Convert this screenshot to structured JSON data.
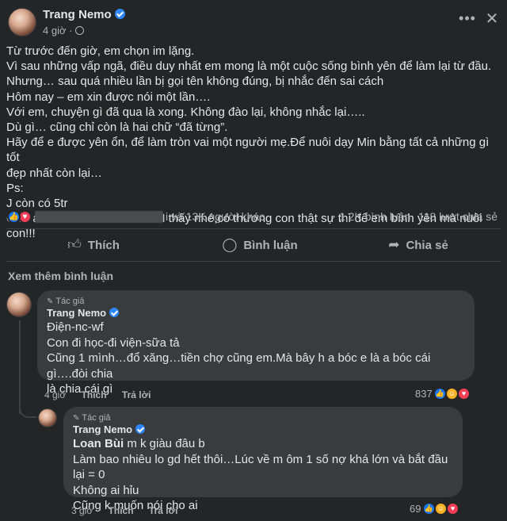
{
  "post": {
    "author": "Trang Nemo",
    "time": "4 giờ",
    "body_lines": [
      "Từ trước đến giờ, em chọn im lặng.",
      "Vì sau những vấp ngã, điều duy nhất em mong là một cuộc sống bình yên để làm lại từ đầu.",
      "Nhưng… sau quá nhiều lần bị gọi tên không đúng, bị nhắc đến sai cách",
      "Hôm nay – em xin được nói một lần….",
      "Với em, chuyện gì đã qua là xong. Không đào lại, không nhắc lại…..",
      "Dù gì… cũng chỉ còn là hai chữ “đã từng”.",
      "Hãy để e được yên ổn, để làm tròn vai một người mẹ.Để nuôi dạy Min bằng tất cả những gì tốt",
      "đẹp nhất còn lại…",
      "Ps:",
      "J còn có 5tr",
      "Chứ a thì 500k CHƯA-BAO-H thấy nhé,có thương con thật sự thì để em bình yên mà nuôi con!!!"
    ]
  },
  "reactions": {
    "summary": "i và 13K người khác",
    "comments": "1,2K bình luận",
    "shares": "118 lượt chia sẻ"
  },
  "actions": {
    "like": "Thích",
    "comment": "Bình luận",
    "share": "Chia sẻ"
  },
  "see_more": "Xem thêm bình luận",
  "comments": [
    {
      "tag": "Tác giả",
      "author": "Trang Nemo",
      "lines": [
        "Điện-nc-wf",
        "Con đi học-đi viện-sữa tả",
        "Cũng 1 mình…đổ xăng…tiền chợ cũng em.Mà bây h a bóc e là a bóc cái gì….đòi chia",
        "là chia cái gì"
      ],
      "time": "4 giờ",
      "like": "Thích",
      "reply": "Trả lời",
      "count": "837"
    },
    {
      "tag": "Tác giả",
      "author": "Trang Nemo",
      "mention": "Loan Bùi",
      "lines": [
        " m k giàu đâu b",
        "Làm bao nhiêu lo gd hết thôi…Lúc về m ôm 1 số nợ khá lớn và bắt đầu lại = 0",
        "Không ai hỉu",
        "Cũng k muốn nói cho ai"
      ],
      "time": "3 giờ",
      "like": "Thích",
      "reply": "Trả lời",
      "count": "69"
    }
  ],
  "icons": {
    "more": "more-dots-icon",
    "close": "close-icon",
    "like": "thumbs-up-icon",
    "comment": "speech-bubble-icon",
    "share": "share-arrow-icon"
  },
  "colors": {
    "background": "#242526",
    "bubble": "#3a3b3c",
    "text": "#e4e6eb",
    "muted": "#b0b3b8",
    "verified": "#2d88ff",
    "like_blue": "#1877f2",
    "love_red": "#f33e58"
  }
}
